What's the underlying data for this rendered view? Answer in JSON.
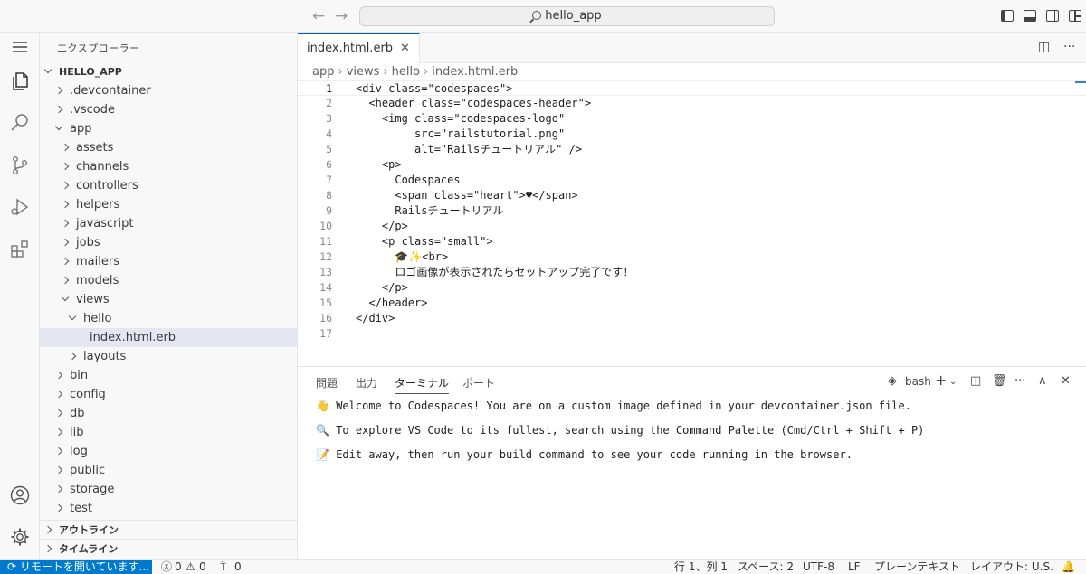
{
  "title": {
    "command_center": "hello_app"
  },
  "sidebar": {
    "title": "エクスプローラー",
    "root": "HELLO_APP",
    "items": [
      {
        "label": ".devcontainer",
        "depth": 1,
        "expanded": false
      },
      {
        "label": ".vscode",
        "depth": 1,
        "expanded": false
      },
      {
        "label": "app",
        "depth": 1,
        "expanded": true
      },
      {
        "label": "assets",
        "depth": 2,
        "expanded": false
      },
      {
        "label": "channels",
        "depth": 2,
        "expanded": false
      },
      {
        "label": "controllers",
        "depth": 2,
        "expanded": false
      },
      {
        "label": "helpers",
        "depth": 2,
        "expanded": false
      },
      {
        "label": "javascript",
        "depth": 2,
        "expanded": false
      },
      {
        "label": "jobs",
        "depth": 2,
        "expanded": false
      },
      {
        "label": "mailers",
        "depth": 2,
        "expanded": false
      },
      {
        "label": "models",
        "depth": 2,
        "expanded": false
      },
      {
        "label": "views",
        "depth": 2,
        "expanded": true
      },
      {
        "label": "hello",
        "depth": 3,
        "expanded": true
      },
      {
        "label": "index.html.erb",
        "depth": 4,
        "file": true,
        "selected": true
      },
      {
        "label": "layouts",
        "depth": 3,
        "expanded": false
      },
      {
        "label": "bin",
        "depth": 1,
        "expanded": false
      },
      {
        "label": "config",
        "depth": 1,
        "expanded": false
      },
      {
        "label": "db",
        "depth": 1,
        "expanded": false
      },
      {
        "label": "lib",
        "depth": 1,
        "expanded": false
      },
      {
        "label": "log",
        "depth": 1,
        "expanded": false
      },
      {
        "label": "public",
        "depth": 1,
        "expanded": false
      },
      {
        "label": "storage",
        "depth": 1,
        "expanded": false
      },
      {
        "label": "test",
        "depth": 1,
        "expanded": false
      }
    ],
    "sections": [
      "アウトライン",
      "タイムライン"
    ]
  },
  "editor": {
    "tab_label": "index.html.erb",
    "breadcrumb": [
      "app",
      "views",
      "hello",
      "index.html.erb"
    ],
    "lines": [
      "<div class=\"codespaces\">",
      "  <header class=\"codespaces-header\">",
      "    <img class=\"codespaces-logo\"",
      "         src=\"railstutorial.png\"",
      "         alt=\"Railsチュートリアル\" />",
      "    <p>",
      "      Codespaces",
      "      <span class=\"heart\">♥</span>",
      "      Railsチュートリアル",
      "    </p>",
      "    <p class=\"small\">",
      "      🎓✨<br>",
      "      ロゴ画像が表示されたらセットアップ完了です！",
      "    </p>",
      "  </header>",
      "</div>",
      ""
    ],
    "active_line": 1
  },
  "panel": {
    "tabs": [
      "問題",
      "出力",
      "ターミナル",
      "ポート"
    ],
    "active_tab": "ターミナル",
    "shell": "bash",
    "terminal_lines": [
      {
        "icon": "👋",
        "text": "Welcome to Codespaces! You are on a custom image defined in your devcontainer.json file."
      },
      {
        "icon": "🔍",
        "text": "To explore VS Code to its fullest, search using the Command Palette (Cmd/Ctrl + Shift + P)"
      },
      {
        "icon": "📝",
        "text": "Edit away, then run your build command to see your code running in the browser."
      }
    ]
  },
  "statusbar": {
    "remote": "リモートを開いています...",
    "errors": "0",
    "warnings": "0",
    "ports": "0",
    "position": "行 1、列 1",
    "spaces": "スペース: 2",
    "encoding": "UTF-8",
    "eol": "LF",
    "language": "プレーンテキスト",
    "layout": "レイアウト: U.S."
  },
  "colors": {
    "accent": "#007acc",
    "tab_border": "#005fb8",
    "selection": "#e4e6f1"
  }
}
